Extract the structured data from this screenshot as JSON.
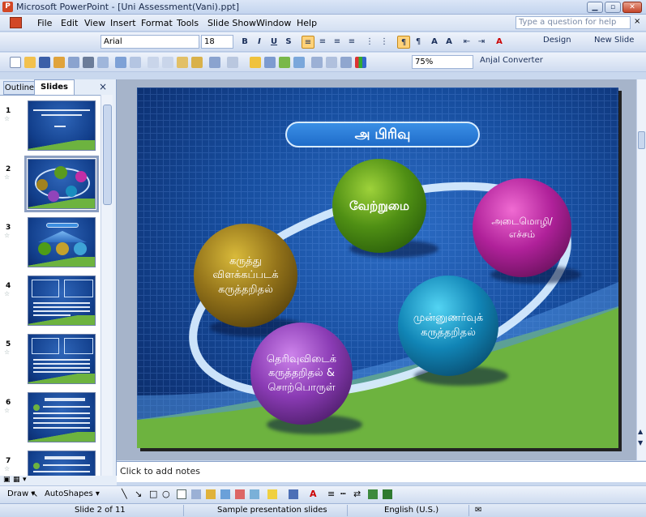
{
  "window": {
    "title": "Microsoft PowerPoint - [Uni Assessment(Vani).ppt]",
    "min": "▁",
    "max": "▫",
    "close": "✕"
  },
  "menu": {
    "items": [
      "File",
      "Edit",
      "View",
      "Insert",
      "Format",
      "Tools",
      "Slide Show",
      "Window",
      "Help"
    ],
    "help_placeholder": "Type a question for help",
    "close": "×"
  },
  "format_toolbar": {
    "font_name": "Arial",
    "font_size": "18",
    "bold": "B",
    "italic": "I",
    "underline": "U",
    "shadow": "S",
    "design": "Design",
    "new_slide": "New Slide"
  },
  "standard_toolbar": {
    "zoom": "75%",
    "anjal": "Anjal Converter"
  },
  "left_pane": {
    "tabs": [
      "Outline",
      "Slides"
    ],
    "close": "×",
    "thumbnails": [
      {
        "num": "1",
        "star": "☆"
      },
      {
        "num": "2",
        "star": "☆",
        "selected": true
      },
      {
        "num": "3",
        "star": "☆"
      },
      {
        "num": "4",
        "star": "☆"
      },
      {
        "num": "5",
        "star": "☆"
      },
      {
        "num": "6",
        "star": "☆"
      },
      {
        "num": "7",
        "star": "☆"
      }
    ]
  },
  "slide": {
    "title": "அ பிரிவு",
    "bubbles": {
      "center": "வேற்றுமை",
      "right": "அடைமொழி/ எச்சம்",
      "left": "கருத்து விளக்கப்படக் கருத்தறிதல்",
      "lower_right": "முன்னுணர்வுக் கருத்தறிதல்",
      "lower_left": "தெரிவுவிடைக் கருத்தறிதல் & சொற்பொருள்"
    },
    "colors": {
      "background": "#174e9f",
      "accent_green": "#6db33f",
      "title_fill": "#2a7ddb"
    }
  },
  "notes": {
    "placeholder": "Click to add notes"
  },
  "draw_toolbar": {
    "draw": "Draw ▾",
    "autoshapes": "AutoShapes ▾"
  },
  "status": {
    "slide": "Slide 2 of 11",
    "design": "Sample presentation slides",
    "language": "English (U.S.)"
  }
}
